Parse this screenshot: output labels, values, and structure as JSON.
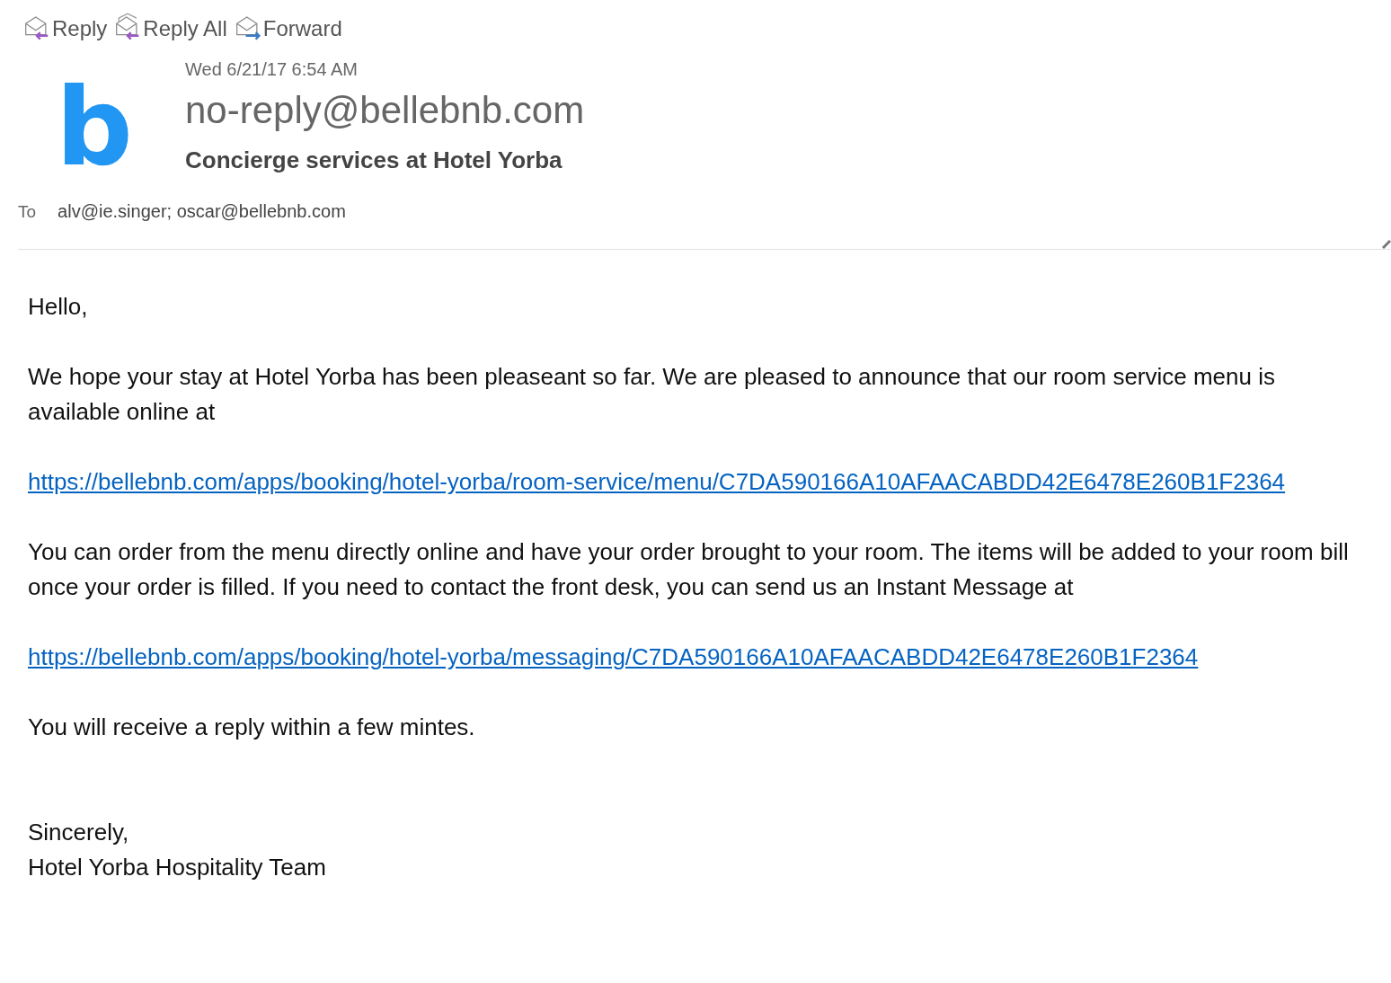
{
  "toolbar": [
    {
      "kind": "reply",
      "label": "Reply"
    },
    {
      "kind": "reply_all",
      "label": "Reply All"
    },
    {
      "kind": "forward",
      "label": "Forward"
    }
  ],
  "header": {
    "avatar_letter": "b",
    "date": "Wed 6/21/17 6:54 AM",
    "sender": "no-reply@bellebnb.com",
    "subject": "Concierge services at Hotel Yorba",
    "to_label": "To",
    "recipients": "alv@ie.singer; oscar@bellebnb.com"
  },
  "body": [
    {
      "kind": "text",
      "text": "Hello,"
    },
    {
      "kind": "text",
      "text": "We hope your stay at Hotel Yorba has been pleaseant so far. We are pleased to announce that our room service menu is available online at"
    },
    {
      "kind": "link",
      "text": "https://bellebnb.com/apps/booking/hotel-yorba/room-service/menu/C7DA590166A10AFAACABDD42E6478E260B1F2364"
    },
    {
      "kind": "text",
      "text": "You can order from the menu directly online and have your order brought to your room. The items will be added to your room bill once your order is filled. If you need to contact the front desk, you can send us an Instant Message at"
    },
    {
      "kind": "link",
      "text": "https://bellebnb.com/apps/booking/hotel-yorba/messaging/C7DA590166A10AFAACABDD42E6478E260B1F2364"
    },
    {
      "kind": "text",
      "text": "You will receive a reply within a few mintes."
    },
    {
      "kind": "signoff",
      "text": "Sincerely,"
    },
    {
      "kind": "text",
      "text": "Hotel Yorba Hospitality Team"
    }
  ]
}
